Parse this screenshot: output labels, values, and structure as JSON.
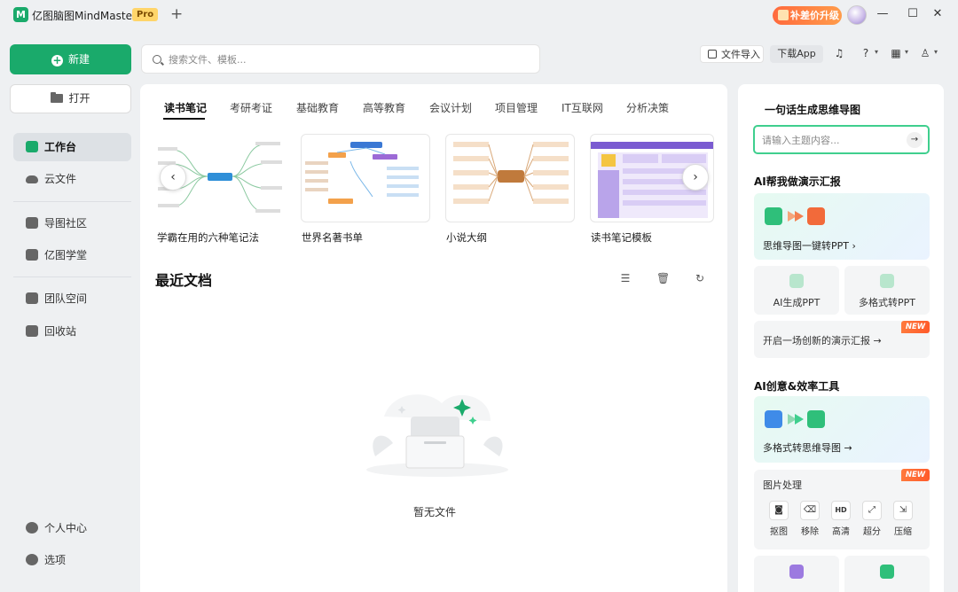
{
  "titlebar": {
    "app_name": "亿图脑图MindMaster",
    "pro_badge": "Pro",
    "new_tab_symbol": "+",
    "upgrade_label": "补差价升级",
    "minimize": "—",
    "maximize": "☐",
    "close": "✕"
  },
  "sidebar": {
    "new_label": "新建",
    "open_label": "打开",
    "items": [
      {
        "label": "工作台",
        "icon": "workbench-icon",
        "active": true
      },
      {
        "label": "云文件",
        "icon": "cloud-icon"
      },
      {
        "label": "导图社区",
        "icon": "community-icon"
      },
      {
        "label": "亿图学堂",
        "icon": "school-icon"
      },
      {
        "label": "团队空间",
        "icon": "team-icon"
      },
      {
        "label": "回收站",
        "icon": "trash-icon"
      }
    ],
    "bottom_items": [
      {
        "label": "个人中心",
        "icon": "user-icon"
      },
      {
        "label": "选项",
        "icon": "gear-icon"
      }
    ]
  },
  "search": {
    "placeholder": "搜索文件、模板..."
  },
  "toolbar": {
    "import_label": "文件导入",
    "download_label": "下载App"
  },
  "templates": {
    "tabs": [
      "读书笔记",
      "考研考证",
      "基础教育",
      "高等教育",
      "会议计划",
      "项目管理",
      "IT互联网",
      "分析决策"
    ],
    "active_tab": 0,
    "cards": [
      {
        "label": "学霸在用的六种笔记法"
      },
      {
        "label": "世界名著书单"
      },
      {
        "label": "小说大纲"
      },
      {
        "label": "读书笔记模板"
      }
    ],
    "prev_arrow": "‹",
    "next_arrow": "›"
  },
  "recent": {
    "title": "最近文档",
    "empty_text": "暂无文件"
  },
  "right_panel": {
    "ai_title": "一句话生成思维导图",
    "ai_placeholder": "请输入主题内容...",
    "send_symbol": "→",
    "report_title": "AI帮我做演示汇报",
    "mindmap_to_ppt": "思维导图一键转PPT ›",
    "ai_ppt": "AI生成PPT",
    "multi_to_ppt": "多格式转PPT",
    "new_report": "开启一场创新的演示汇报 →",
    "new_tag": "NEW",
    "tools_title": "AI创意&效率工具",
    "multi_to_mindmap": "多格式转思维导图 →",
    "image_processing": "图片处理",
    "image_tools": [
      {
        "label": "抠图",
        "icon": "cutout-icon"
      },
      {
        "label": "移除",
        "icon": "eraser-icon"
      },
      {
        "label": "高清",
        "icon": "hd-icon"
      },
      {
        "label": "超分",
        "icon": "upscale-icon"
      },
      {
        "label": "压缩",
        "icon": "compress-icon"
      }
    ],
    "hd_text": "HD"
  },
  "colors": {
    "brand": "#1aaa6b",
    "accent_border": "#3fcf8e",
    "new_tag": "#ff5a2a"
  }
}
